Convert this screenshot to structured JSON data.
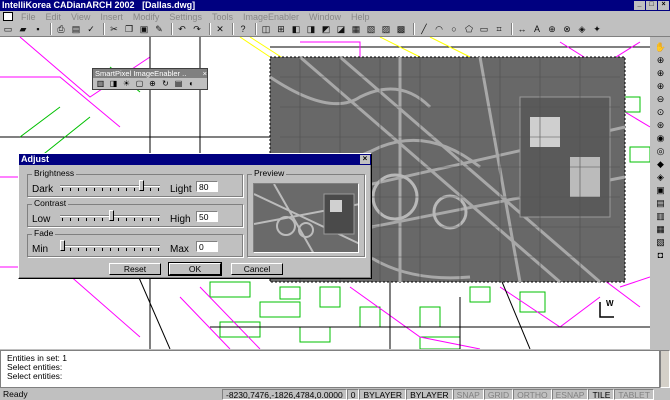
{
  "window": {
    "title": "IntelliKorea CADianARCH 2002",
    "document": "[Dallas.dwg]"
  },
  "menu": [
    "File",
    "Edit",
    "View",
    "Insert",
    "Modify",
    "Settings",
    "Tools",
    "ImageEnabler",
    "Window",
    "Help"
  ],
  "smartpixel_toolbar": {
    "title": "SmartPixel ImageEnabler .."
  },
  "dialog": {
    "title": "Adjust",
    "brightness": {
      "group": "Brightness",
      "left": "Dark",
      "right": "Light",
      "value": "80"
    },
    "contrast": {
      "group": "Contrast",
      "left": "Low",
      "right": "High",
      "value": "50"
    },
    "fade": {
      "group": "Fade",
      "left": "Min",
      "right": "Max",
      "value": "0"
    },
    "preview_label": "Preview",
    "buttons": {
      "reset": "Reset",
      "ok": "OK",
      "cancel": "Cancel"
    }
  },
  "command": {
    "lines": [
      "Entities in set: 1",
      "Select entities:",
      "Select entities:"
    ]
  },
  "status": {
    "ready": "Ready",
    "coords": "-8230,7476,-1826,4784,0.0000",
    "layer_num": "0",
    "bylayer1": "BYLAYER",
    "bylayer2": "BYLAYER",
    "snap": "SNAP",
    "grid": "GRID",
    "ortho": "ORTHO",
    "esnap": "ESNAP",
    "tile": "TILE",
    "tablet": "TABLET"
  },
  "ucs_label": "W"
}
